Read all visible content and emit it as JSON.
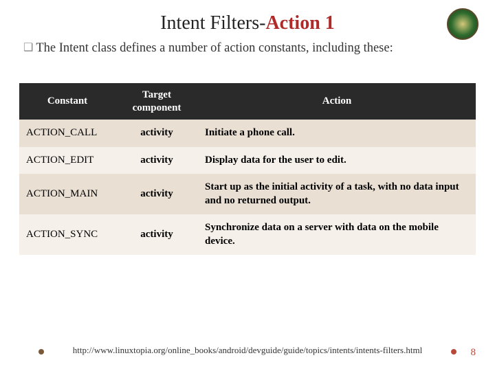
{
  "title": {
    "pre": "Intent Filters-",
    "accent": "Action 1"
  },
  "intro": "The Intent class defines a number of action constants, including these:",
  "table": {
    "headers": [
      "Constant",
      "Target component",
      "Action"
    ],
    "rows": [
      {
        "constant": "ACTION_CALL",
        "target": "activity",
        "action": "Initiate a phone call."
      },
      {
        "constant": "ACTION_EDIT",
        "target": "activity",
        "action": "Display data for the user to edit."
      },
      {
        "constant": "ACTION_MAIN",
        "target": "activity",
        "action": "Start up as the initial activity of a task, with no data input and no returned output."
      },
      {
        "constant": "ACTION_SYNC",
        "target": "activity",
        "action": "Synchronize data on a server with data on the mobile device."
      }
    ]
  },
  "footer_url": "http://www.linuxtopia.org/online_books/android/devguide/guide/topics/intents/intents-filters.html",
  "page_number": "8"
}
